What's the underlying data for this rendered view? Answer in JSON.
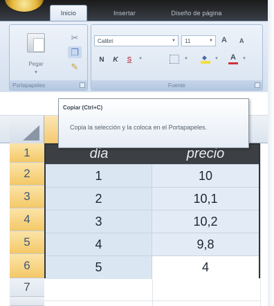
{
  "ribbon": {
    "tabs": [
      {
        "label": "Inicio",
        "active": true
      },
      {
        "label": "Insertar",
        "active": false
      },
      {
        "label": "Diseño de página",
        "active": false
      }
    ],
    "clipboard": {
      "paste_label": "Pegar",
      "group_label": "Portapapeles",
      "icons": [
        "cut-icon",
        "copy-icon",
        "format-painter-icon"
      ]
    },
    "font": {
      "font_name": "Calibri",
      "font_size": "11",
      "grow_label": "A",
      "shrink_label": "A",
      "bold_label": "N",
      "italic_label": "K",
      "underline_label": "S",
      "font_color_label": "A",
      "group_label": "Fuente"
    }
  },
  "tooltip": {
    "title": "Copiar (Ctrl+C)",
    "body": "Copia la selección y la coloca en el Portapapeles."
  },
  "sheet": {
    "row_numbers": [
      "1",
      "2",
      "3",
      "4",
      "5",
      "6",
      "7"
    ],
    "table": {
      "headers": [
        "dia",
        "precio"
      ],
      "rows": [
        [
          "1",
          "10"
        ],
        [
          "2",
          "10,1"
        ],
        [
          "3",
          "10,2"
        ],
        [
          "4",
          "9,8"
        ],
        [
          "5",
          "4"
        ]
      ]
    }
  },
  "colors": {
    "table_header_bg": "#3c3f43",
    "cell_fill": "#dbe6f3",
    "selected_row_header": "#f4c867",
    "ribbon_bg": "#dfe8f3"
  }
}
